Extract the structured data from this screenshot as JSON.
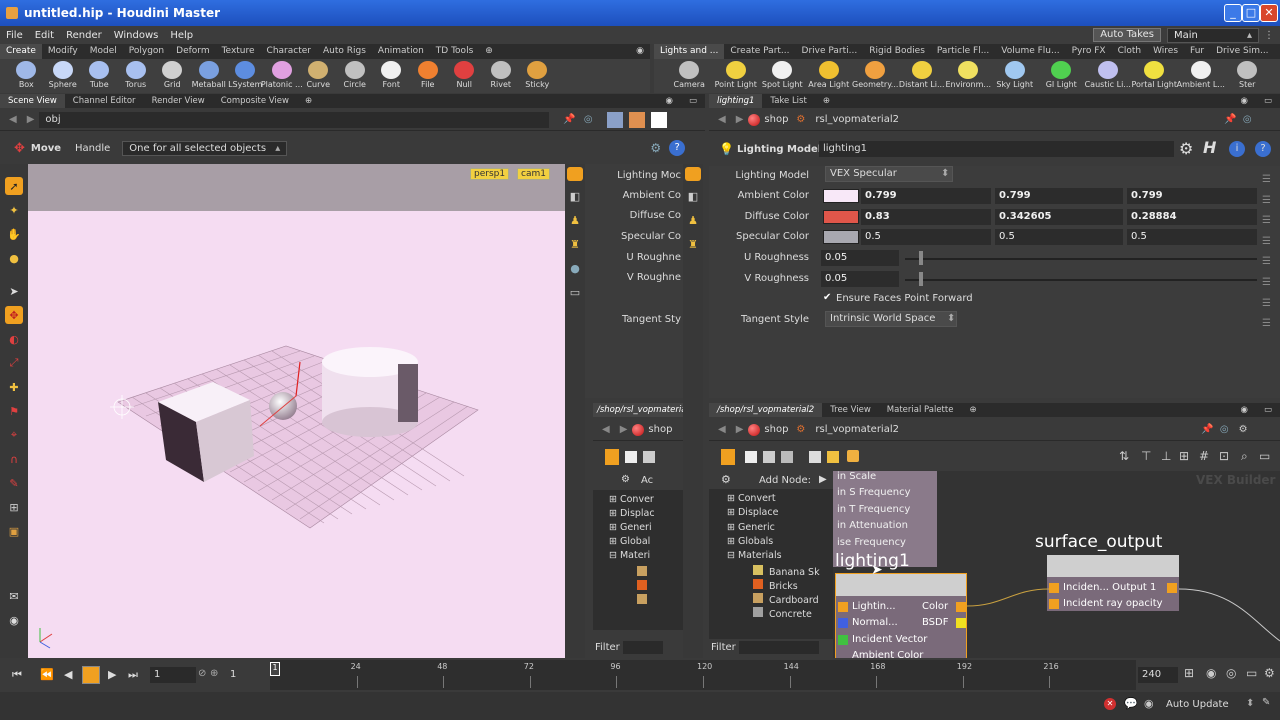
{
  "window": {
    "title": "untitled.hip - Houdini Master"
  },
  "menu": {
    "items": [
      "File",
      "Edit",
      "Render",
      "Windows",
      "Help"
    ],
    "auto_takes": "Auto Takes",
    "main": "Main"
  },
  "shelf_left": {
    "tabs": [
      "Create",
      "Modify",
      "Model",
      "Polygon",
      "Deform",
      "Texture",
      "Character",
      "Auto Rigs",
      "Animation",
      "TD Tools"
    ],
    "tools": [
      {
        "label": "Box",
        "icon": "box-icon",
        "color": "#9fb8e8"
      },
      {
        "label": "Sphere",
        "icon": "sphere-icon",
        "color": "#c8d8f8"
      },
      {
        "label": "Tube",
        "icon": "tube-icon",
        "color": "#a8c0f0"
      },
      {
        "label": "Torus",
        "icon": "torus-icon",
        "color": "#a8c0f0"
      },
      {
        "label": "Grid",
        "icon": "grid-icon",
        "color": "#d0d0d0"
      },
      {
        "label": "Metaball",
        "icon": "metaball-icon",
        "color": "#7aa0e0"
      },
      {
        "label": "LSystem",
        "icon": "lsystem-icon",
        "color": "#5d8de0"
      },
      {
        "label": "Platonic ...",
        "icon": "platonic-icon",
        "color": "#e0a0e0"
      },
      {
        "label": "Curve",
        "icon": "curve-icon",
        "color": "#d0b070"
      },
      {
        "label": "Circle",
        "icon": "circle-icon",
        "color": "#c0c0c0"
      },
      {
        "label": "Font",
        "icon": "font-icon",
        "color": "#f0f0f0"
      },
      {
        "label": "File",
        "icon": "file-icon",
        "color": "#f08030"
      },
      {
        "label": "Null",
        "icon": "null-icon",
        "color": "#e04040"
      },
      {
        "label": "Rivet",
        "icon": "rivet-icon",
        "color": "#c0c0c0"
      },
      {
        "label": "Sticky",
        "icon": "sticky-icon",
        "color": "#e0a040"
      }
    ]
  },
  "shelf_right": {
    "tabs": [
      "Lights and ...",
      "Create Part...",
      "Drive Parti...",
      "Rigid Bodies",
      "Particle Fl...",
      "Volume Flu...",
      "Pyro FX",
      "Cloth",
      "Wires",
      "Fur",
      "Drive Sim..."
    ],
    "tools": [
      {
        "label": "Camera",
        "icon": "camera-icon",
        "color": "#c0c0c0"
      },
      {
        "label": "Point Light",
        "icon": "point-light-icon",
        "color": "#f0d040"
      },
      {
        "label": "Spot Light",
        "icon": "spot-light-icon",
        "color": "#f0f0f0"
      },
      {
        "label": "Area Light",
        "icon": "area-light-icon",
        "color": "#f0c030"
      },
      {
        "label": "Geometry...",
        "icon": "geometry-light-icon",
        "color": "#f0a040"
      },
      {
        "label": "Distant Li...",
        "icon": "distant-light-icon",
        "color": "#f0d040"
      },
      {
        "label": "Environm...",
        "icon": "environment-light-icon",
        "color": "#f0e060"
      },
      {
        "label": "Sky Light",
        "icon": "sky-light-icon",
        "color": "#a0c8f0"
      },
      {
        "label": "GI Light",
        "icon": "gi-light-icon",
        "color": "#50d050"
      },
      {
        "label": "Caustic Li...",
        "icon": "caustic-light-icon",
        "color": "#c0c0f0"
      },
      {
        "label": "Portal Light",
        "icon": "portal-light-icon",
        "color": "#f0e040"
      },
      {
        "label": "Ambient L...",
        "icon": "ambient-light-icon",
        "color": "#f0f0f0"
      },
      {
        "label": "Ster",
        "icon": "stereo-camera-icon",
        "color": "#c0c0c0"
      }
    ]
  },
  "scene_view": {
    "tabs": [
      "Scene View",
      "Channel Editor",
      "Render View",
      "Composite View"
    ],
    "path": "obj",
    "move_label": "Move",
    "handle_label": "Handle",
    "handle_mode": "One for all selected objects",
    "cam_persp": "persp1",
    "cam_cam": "cam1"
  },
  "mini_params": {
    "tab": "/shop/rsl_vopmateria",
    "labels": [
      "Lighting Moc",
      "Ambient Co",
      "Diffuse Co",
      "Specular Co",
      "U Roughne",
      "V Roughne",
      "Tangent Sty"
    ],
    "path_label": "shop",
    "node_tab": "Ac",
    "tree": [
      "Conver",
      "Displac",
      "Generi",
      "Global",
      "Materi"
    ]
  },
  "params": {
    "tabs": [
      "lighting1",
      "Take List"
    ],
    "path_shop": "shop",
    "path_node": "rsl_vopmaterial2",
    "header_type": "Lighting Model",
    "header_name": "lighting1",
    "rows": {
      "lighting_model": {
        "label": "Lighting Model",
        "value": "VEX Specular"
      },
      "ambient": {
        "label": "Ambient Color",
        "swatch": "#f8e8f8",
        "v1": "0.799",
        "v2": "0.799",
        "v3": "0.799"
      },
      "diffuse": {
        "label": "Diffuse Color",
        "swatch": "#e0564a",
        "v1": "0.83",
        "v2": "0.342605",
        "v3": "0.28884"
      },
      "specular": {
        "label": "Specular Color",
        "swatch": "#a8a8b0",
        "v1": "0.5",
        "v2": "0.5",
        "v3": "0.5"
      },
      "u_rough": {
        "label": "U Roughness",
        "value": "0.05"
      },
      "v_rough": {
        "label": "V Roughness",
        "value": "0.05"
      },
      "ensure": {
        "label": "Ensure Faces Point Forward"
      },
      "tangent": {
        "label": "Tangent Style",
        "value": "Intrinsic World Space"
      }
    }
  },
  "network": {
    "tabs": [
      "/shop/rsl_vopmaterial2",
      "Tree View",
      "Material Palette"
    ],
    "path_shop": "shop",
    "path_node": "rsl_vopmaterial2",
    "add_node": "Add Node:",
    "watermark": "VEX Builder",
    "tree": [
      {
        "label": "Convert",
        "level": 0
      },
      {
        "label": "Displace",
        "level": 0
      },
      {
        "label": "Generic",
        "level": 0
      },
      {
        "label": "Globals",
        "level": 0
      },
      {
        "label": "Materials",
        "level": 0
      },
      {
        "label": "Banana Sk",
        "level": 1
      },
      {
        "label": "Bricks",
        "level": 1
      },
      {
        "label": "Cardboard",
        "level": 1
      },
      {
        "label": "Concrete",
        "level": 1
      }
    ],
    "filter_label": "Filter",
    "param_list": [
      "in Scale",
      "in S Frequency",
      "in T Frequency",
      "in Attenuation",
      "ise Frequency"
    ],
    "lighting_node": {
      "name": "lighting1",
      "inputs": [
        "Lightin...",
        "Normal...",
        "Incident Vector",
        "Ambient Color"
      ],
      "outputs": [
        "Color",
        "BSDF"
      ]
    },
    "output_node": {
      "name": "surface_output",
      "inputs": [
        "Inciden... Output 1",
        "Incident ray opacity"
      ]
    }
  },
  "timeline": {
    "frame": "1",
    "start": "1",
    "end": "240",
    "ticks": [
      "1",
      "24",
      "48",
      "72",
      "96",
      "120",
      "144",
      "168",
      "192",
      "216"
    ],
    "auto_update": "Auto Update"
  },
  "colors": {
    "accent": "#f0a020",
    "viewport_bg": "#f5dcf2",
    "node_bg": "#c8c8c8"
  }
}
